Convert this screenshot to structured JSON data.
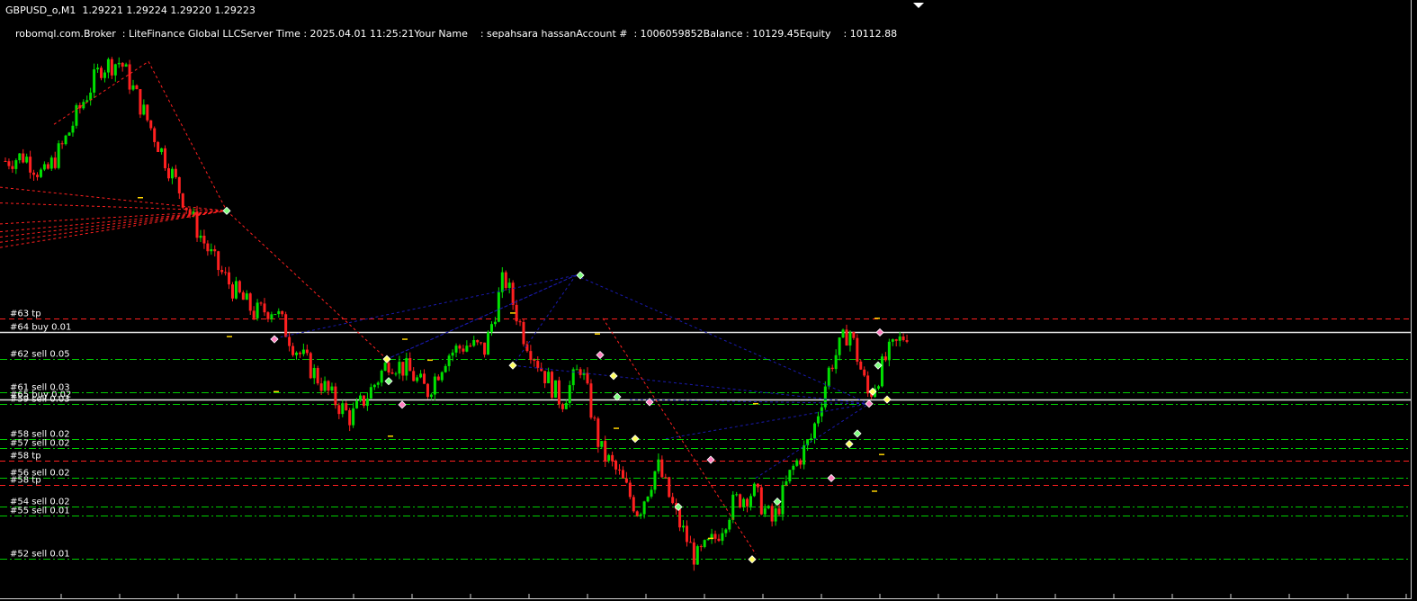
{
  "header": {
    "symbol_line": "GBPUSD_o,M1  1.29221 1.29224 1.29220 1.29223",
    "account_line": "robomql.com.Broker  : LiteFinance Global LLCServer Time : 2025.04.01 11:25:21Your Name    : sepahsara hassanAccount #  : 1006059852Balance : 10129.45Equity    : 10112.88"
  },
  "colors": {
    "background": "#000000",
    "bull": "#00e000",
    "bear": "#ff2020",
    "tp_line": "#ff2020",
    "sell_line": "#00cc00",
    "buy_line": "#e8e8e8",
    "link_line": "#1a1ab0",
    "trail_line": "#ff2020"
  },
  "chart_data": {
    "type": "candlestick",
    "symbol": "GBPUSD_o",
    "timeframe": "M1",
    "ohlc_last": {
      "open": 1.29221,
      "high": 1.29224,
      "low": 1.2922,
      "close": 1.29223
    },
    "order_levels": [
      {
        "label": "#63 tp",
        "kind": "tp",
        "price": 1.2925
      },
      {
        "label": "#64 buy 0.01",
        "kind": "buy",
        "price": 1.29223
      },
      {
        "label": "#62 sell 0.05",
        "kind": "sell",
        "price": 1.29172
      },
      {
        "label": "#61 sell 0.03",
        "kind": "sell",
        "price": 1.29108
      },
      {
        "label": "#65 buy 0.02",
        "kind": "buy",
        "price": 1.29095
      },
      {
        "label": "#59 sell 0.03",
        "kind": "sell",
        "price": 1.29087
      },
      {
        "label": "#58 sell 0.02",
        "kind": "sell",
        "price": 1.2902
      },
      {
        "label": "#57 sell 0.02",
        "kind": "sell",
        "price": 1.29003
      },
      {
        "label": "#58 tp",
        "kind": "tp",
        "price": 1.28978
      },
      {
        "label": "#56 sell 0.02",
        "kind": "sell",
        "price": 1.28945
      },
      {
        "label": "#58 tp",
        "kind": "tp",
        "price": 1.28932
      },
      {
        "label": "#54 sell 0.02",
        "kind": "sell",
        "price": 1.2889
      },
      {
        "label": "#55 sell 0.01",
        "kind": "sell",
        "price": 1.28874
      },
      {
        "label": "#52 sell 0.01",
        "kind": "sell",
        "price": 1.28792
      }
    ],
    "price_path": [
      1.2955,
      1.2956,
      1.2952,
      1.2958,
      1.2966,
      1.2973,
      1.2974,
      1.2966,
      1.2958,
      1.295,
      1.2942,
      1.2935,
      1.293,
      1.2926,
      1.2927,
      1.292,
      1.2915,
      1.291,
      1.2906,
      1.2911,
      1.2917,
      1.2915,
      1.2911,
      1.2918,
      1.292,
      1.2919,
      1.2933,
      1.2922,
      1.2915,
      1.2909,
      1.2916,
      1.29,
      1.2895,
      1.2888,
      1.2897,
      1.2887,
      1.2879,
      1.2883,
      1.289,
      1.2892,
      1.2886,
      1.2896,
      1.2902,
      1.2916,
      1.2923,
      1.291,
      1.2918,
      1.29223
    ]
  }
}
